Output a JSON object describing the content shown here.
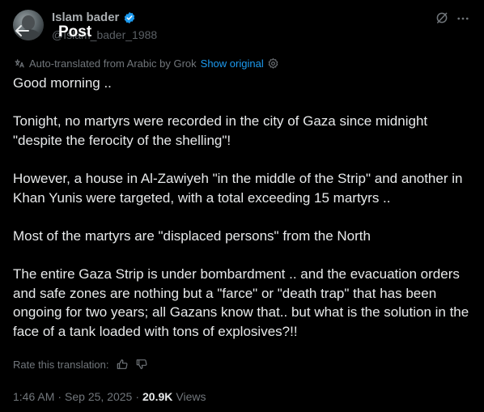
{
  "header": {
    "title": "Post",
    "author_name": "Islam bader",
    "author_handle": "@Islam_bader_1988"
  },
  "translation": {
    "note": "Auto-translated from Arabic by Grok",
    "show_original_label": "Show original",
    "rate_label": "Rate this translation:"
  },
  "post": {
    "paragraphs": [
      "Good morning ..",
      "Tonight, no martyrs were recorded in the city of Gaza since midnight \"despite the ferocity of the shelling\"!",
      "However, a house in Al-Zawiyeh \"in the middle of the Strip\" and another in Khan Yunis were targeted, with a total exceeding 15 martyrs ..",
      "Most of the martyrs are \"displaced persons\" from the North",
      "The entire Gaza Strip is under bombardment .. and the evacuation orders and safe zones are nothing but a \"farce\" or \"death trap\" that has been ongoing for two years; all Gazans know that.. but what is the solution in the face of a tank loaded with tons of explosives?!!"
    ]
  },
  "meta": {
    "time": "1:46 AM",
    "separator": "·",
    "date": "Sep 25, 2025",
    "views_count": "20.9K",
    "views_label": "Views"
  },
  "icons": {
    "back": "arrow-left-icon",
    "verified": "verified-badge-icon",
    "grok": "grok-icon",
    "more": "more-icon",
    "globe": "globe-icon",
    "settings": "settings-icon",
    "thumbs_up": "thumbs-up-icon",
    "thumbs_down": "thumbs-down-icon"
  },
  "colors": {
    "background": "#000000",
    "text": "#e7e9ea",
    "secondary": "#71767b",
    "accent": "#1d9bf0"
  }
}
